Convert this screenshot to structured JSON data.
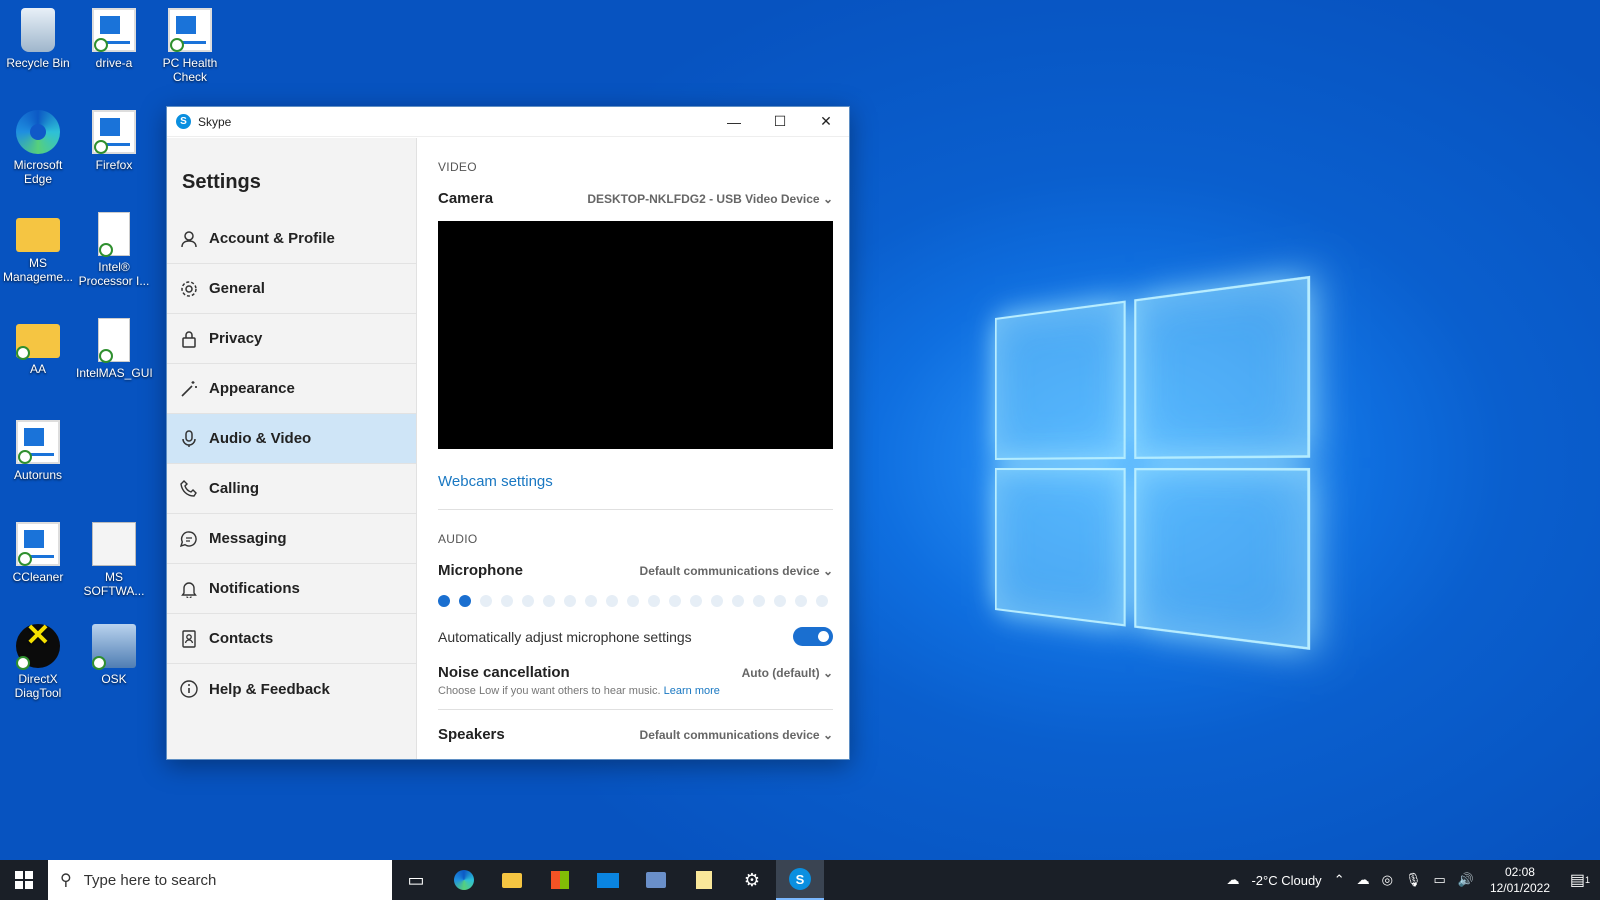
{
  "desktop": {
    "icons": [
      {
        "label": "Recycle Bin",
        "icon": "recycle-bin-icon"
      },
      {
        "label": "drive-a",
        "icon": "shortcut-icon"
      },
      {
        "label": "PC Health Check",
        "icon": "shortcut-icon"
      },
      {
        "label": "Microsoft Edge",
        "icon": "edge-icon"
      },
      {
        "label": "Firefox",
        "icon": "shortcut-icon"
      },
      {
        "label": "MS Manageme...",
        "icon": "folder-icon"
      },
      {
        "label": "Intel® Processor I...",
        "icon": "document-icon"
      },
      {
        "label": "AA",
        "icon": "folder-icon"
      },
      {
        "label": "IntelMAS_GUI",
        "icon": "document-icon"
      },
      {
        "label": "Autoruns",
        "icon": "shortcut-icon"
      },
      {
        "label": "CCleaner",
        "icon": "shortcut-icon"
      },
      {
        "label": "MS SOFTWA...",
        "icon": "document-icon"
      },
      {
        "label": "DirectX DiagTool",
        "icon": "directx-icon"
      },
      {
        "label": "OSK",
        "icon": "keyboard-icon"
      }
    ]
  },
  "window": {
    "title": "Skype",
    "controls": {
      "minimize": "—",
      "maximize": "☐",
      "close": "✕"
    }
  },
  "sidebar": {
    "title": "Settings",
    "items": [
      {
        "label": "Account & Profile",
        "icon": "user-icon"
      },
      {
        "label": "General",
        "icon": "gear-icon"
      },
      {
        "label": "Privacy",
        "icon": "lock-icon"
      },
      {
        "label": "Appearance",
        "icon": "magic-wand-icon"
      },
      {
        "label": "Audio & Video",
        "icon": "microphone-icon"
      },
      {
        "label": "Calling",
        "icon": "phone-icon"
      },
      {
        "label": "Messaging",
        "icon": "chat-icon"
      },
      {
        "label": "Notifications",
        "icon": "bell-icon"
      },
      {
        "label": "Contacts",
        "icon": "contacts-icon"
      },
      {
        "label": "Help & Feedback",
        "icon": "info-icon"
      }
    ],
    "active_index": 4
  },
  "video": {
    "section": "VIDEO",
    "camera_label": "Camera",
    "camera_value": "DESKTOP-NKLFDG2 - USB Video Device",
    "webcam_settings": "Webcam settings"
  },
  "audio": {
    "section": "AUDIO",
    "microphone_label": "Microphone",
    "microphone_value": "Default communications device",
    "mic_level": {
      "active": 2,
      "total": 19
    },
    "auto_adjust_label": "Automatically adjust microphone settings",
    "auto_adjust_on": true,
    "noise_label": "Noise cancellation",
    "noise_value": "Auto (default)",
    "noise_hint": "Choose Low if you want others to hear music.",
    "learn_more": "Learn more",
    "speakers_label": "Speakers",
    "speakers_value": "Default communications device"
  },
  "taskbar": {
    "search_placeholder": "Type here to search",
    "weather": "-2°C  Cloudy",
    "time": "02:08",
    "date": "12/01/2022",
    "notification_count": "1"
  },
  "colors": {
    "accent": "#1a6fd0",
    "active_nav": "#cfe5f7",
    "link": "#1a78c2"
  }
}
